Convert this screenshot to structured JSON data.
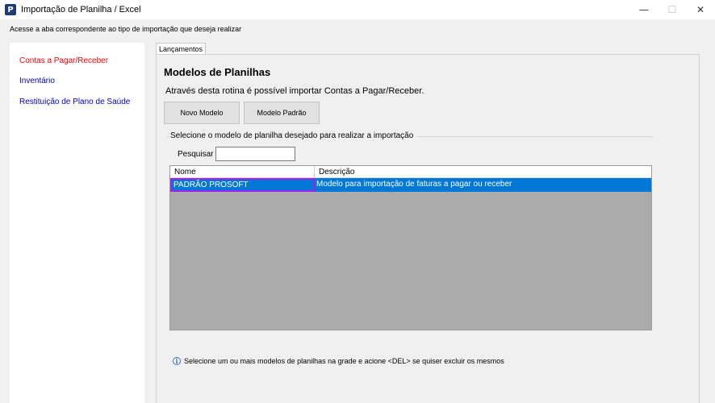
{
  "window": {
    "title": "Importação de Planilha / Excel",
    "app_icon_letter": "P",
    "minimize": "—",
    "maximize": "☐",
    "close": "✕"
  },
  "header_hint": "Acesse a aba correspondente ao tipo de importação que deseja realizar",
  "sidebar": {
    "items": [
      {
        "label": "Contas a Pagar/Receber",
        "active": true
      },
      {
        "label": "Inventário",
        "active": false
      },
      {
        "label": "Restituição de Plano de Saúde",
        "active": false
      }
    ]
  },
  "tabs": [
    {
      "label": "Lançamentos"
    }
  ],
  "main": {
    "title": "Modelos de Planilhas",
    "description": "Através desta rotina é possível importar Contas a Pagar/Receber.",
    "buttons": {
      "new_model": "Novo Modelo",
      "default_model": "Modelo Padrão"
    },
    "group_label": "Selecione o modelo de planilha desejado para realizar a importação",
    "search": {
      "label": "Pesquisar",
      "value": ""
    },
    "grid": {
      "columns": [
        "Nome",
        "Descrição"
      ],
      "rows": [
        {
          "name": "PADRÃO PROSOFT",
          "description": "Modelo para importação de faturas a pagar ou receber"
        }
      ]
    },
    "info": "Selecione um ou mais modelos de planilhas na grade e acione <DEL> se quiser excluir os mesmos",
    "info_icon": "i"
  },
  "colors": {
    "accent": "#0078d7",
    "active_link": "#ff0000",
    "link": "#0000cc",
    "selection_border": "#a020f0"
  }
}
